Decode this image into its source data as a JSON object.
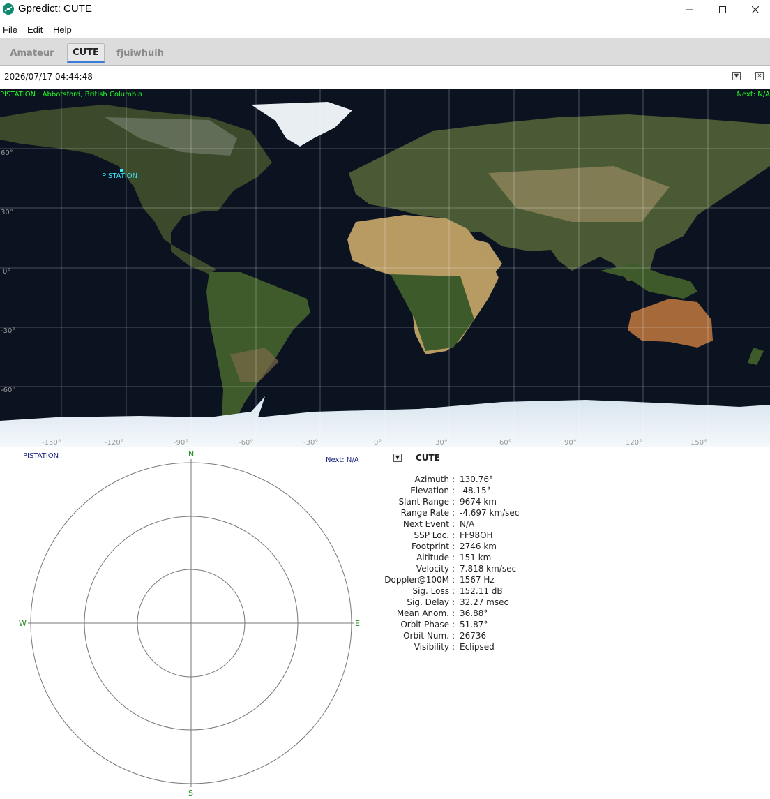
{
  "window": {
    "title": "Gpredict: CUTE"
  },
  "menu": [
    "File",
    "Edit",
    "Help"
  ],
  "tabs": [
    {
      "label": "Amateur",
      "active": false
    },
    {
      "label": "CUTE",
      "active": true
    },
    {
      "label": "fjuiwhuih",
      "active": false
    }
  ],
  "timebar": {
    "datetime": "2026/07/17 04:44:48"
  },
  "map": {
    "qth": "PISTATION · Abbotsford, British Columbia",
    "next": "Next: N/A",
    "station": "PISTATION",
    "lat_labels": [
      "60°",
      "30°",
      "0°",
      "-30°",
      "-60°"
    ],
    "lon_labels": [
      "-150°",
      "-120°",
      "-90°",
      "-60°",
      "-30°",
      "0°",
      "30°",
      "60°",
      "90°",
      "120°",
      "150°"
    ]
  },
  "polar": {
    "qth": "PISTATION",
    "next": "Next: N/A",
    "compass": {
      "n": "N",
      "s": "S",
      "e": "E",
      "w": "W"
    }
  },
  "info": {
    "title": "CUTE",
    "rows": [
      {
        "label": "Azimuth",
        "value": "130.76°"
      },
      {
        "label": "Elevation",
        "value": "-48.15°"
      },
      {
        "label": "Slant Range",
        "value": "9674 km"
      },
      {
        "label": "Range Rate",
        "value": "-4.697 km/sec"
      },
      {
        "label": "Next Event",
        "value": "N/A"
      },
      {
        "label": "SSP Loc.",
        "value": "FF98OH"
      },
      {
        "label": "Footprint",
        "value": "2746 km"
      },
      {
        "label": "Altitude",
        "value": "151 km"
      },
      {
        "label": "Velocity",
        "value": "7.818 km/sec"
      },
      {
        "label": "Doppler@100M",
        "value": "1567 Hz"
      },
      {
        "label": "Sig. Loss",
        "value": "152.11 dB"
      },
      {
        "label": "Sig. Delay",
        "value": "32.27 msec"
      },
      {
        "label": "Mean Anom.",
        "value": "36.88°"
      },
      {
        "label": "Orbit Phase",
        "value": "51.87°"
      },
      {
        "label": "Orbit Num.",
        "value": "26736"
      },
      {
        "label": "Visibility",
        "value": "Eclipsed"
      }
    ]
  },
  "colors": {
    "map_label_green": "#22ff22",
    "station_cyan": "#38e8ff",
    "compass_green": "#1a8a1a",
    "tab_accent": "#3a7bd5"
  }
}
